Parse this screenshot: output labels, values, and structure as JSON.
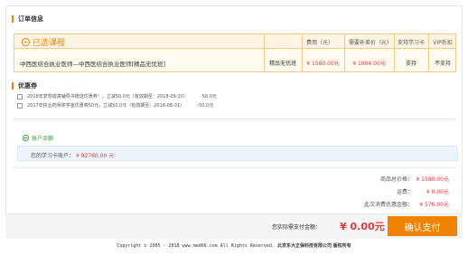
{
  "order_info": {
    "title": "订单信息",
    "selected_label": "已选课程",
    "columns": [
      "费用（元）",
      "需要补差价（元）",
      "支持学习卡",
      "VIP折扣"
    ],
    "course": {
      "name": "中西医结合执业医师—中西医结合执业医师[精品无忧班]",
      "type": "精品无忧班",
      "fee": "¥ 1580.00元",
      "diff": "¥ 1004.00元",
      "study_card": "支持",
      "vip": "不支持"
    }
  },
  "coupons": {
    "title": "优惠券",
    "items": [
      {
        "text": "2018年梦想成真辅导书赠送优惠券！，立减50.0元（有效期至：2018-09-30）",
        "amount": "-50.0元"
      },
      {
        "text": "2017年执业药师奖学金优惠券50元，立减50.0元（有效期至：2018-08-31）",
        "amount": "-50.0元"
      }
    ]
  },
  "balance": {
    "label": "账户余额",
    "card_label": "您的学习卡账户：",
    "card_value": "¥ 92760.00 元"
  },
  "summary": {
    "total_label": "商品总价格：",
    "total_value": "¥ 1580.00元",
    "shipping_label": "运费：",
    "shipping_value": "¥ 0.00元",
    "discount_label": "此次消费优惠金额：",
    "discount_value": "¥ 576.00元"
  },
  "payment": {
    "label": "您实际需支付金额：",
    "amount": "¥ 0.00元",
    "button": "确认支付"
  },
  "footer": {
    "copyright": "Copyright © 2005 - 2018 www.med66.com All Rights Reserved.",
    "company": "北京东大正保科技有限公司 版权所有"
  },
  "colors": {
    "accent": "#f08200",
    "price": "#e4393c",
    "balance_green": "#3a9a3a"
  }
}
